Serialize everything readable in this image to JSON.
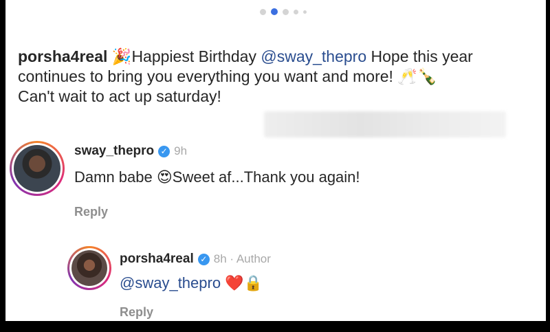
{
  "caption": {
    "username": "porsha4real",
    "party_emoji": "🎉",
    "text_before": "Happiest Birthday ",
    "mention": "@sway_thepro",
    "text_after": " Hope this year continues to bring you everything you want and more! ",
    "emojis": "🥂🍾",
    "line2": " Can't wait to act up saturday!"
  },
  "comments": [
    {
      "username": "sway_thepro",
      "verified": true,
      "time": "9h",
      "text_before": "Damn babe ",
      "emoji": "😍",
      "text_after": "Sweet af...Thank you again!",
      "reply_label": "Reply"
    },
    {
      "username": "porsha4real",
      "verified": true,
      "time": "8h · Author",
      "mention": "@sway_thepro",
      "emojis": " ❤️🔒",
      "reply_label": "Reply"
    }
  ],
  "carousel": {
    "active_index": 1,
    "count": 5
  },
  "colors": {
    "mention": "#2a4d8f",
    "verified": "#3897f0",
    "active_dot": "#3b6fe0"
  }
}
